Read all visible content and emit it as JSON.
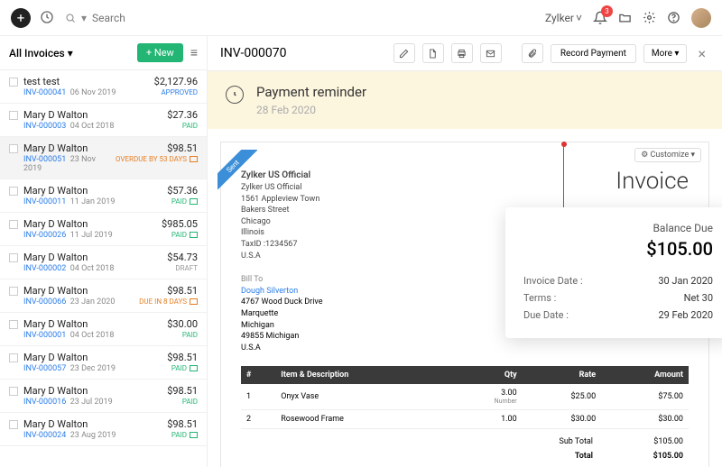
{
  "topbar": {
    "search_placeholder": "Search",
    "org_name": "Zylker",
    "notif_count": "3"
  },
  "sidebar": {
    "title": "All Invoices ▾",
    "new_btn": "+ New",
    "items": [
      {
        "name": "test test",
        "inv": "INV-000041",
        "date": "06 Nov 2019",
        "amount": "$2,127.96",
        "status": "APPROVED",
        "statusClass": "st-approved"
      },
      {
        "name": "Mary D Walton",
        "inv": "INV-000003",
        "date": "04 Oct 2018",
        "amount": "$27.36",
        "status": "PAID",
        "statusClass": "st-paid"
      },
      {
        "name": "Mary D Walton",
        "inv": "INV-000051",
        "date": "23 Nov 2019",
        "amount": "$98.51",
        "status": "OVERDUE BY 53 DAYS",
        "statusClass": "st-overdue",
        "mail": true
      },
      {
        "name": "Mary D Walton",
        "inv": "INV-000011",
        "date": "11 Jan 2019",
        "amount": "$57.36",
        "status": "PAID",
        "statusClass": "st-paid",
        "mail": true
      },
      {
        "name": "Mary D Walton",
        "inv": "INV-000026",
        "date": "11 Jul 2019",
        "amount": "$985.05",
        "status": "PAID",
        "statusClass": "st-paid",
        "mail": true
      },
      {
        "name": "Mary D Walton",
        "inv": "INV-000002",
        "date": "04 Oct 2018",
        "amount": "$54.73",
        "status": "DRAFT",
        "statusClass": "st-draft"
      },
      {
        "name": "Mary D Walton",
        "inv": "INV-000066",
        "date": "23 Jan 2020",
        "amount": "$98.51",
        "status": "DUE IN 8 DAYS",
        "statusClass": "st-due",
        "mail": true
      },
      {
        "name": "Mary D Walton",
        "inv": "INV-000001",
        "date": "04 Oct 2018",
        "amount": "$30.00",
        "status": "PAID",
        "statusClass": "st-paid"
      },
      {
        "name": "Mary D Walton",
        "inv": "INV-000057",
        "date": "23 Dec 2019",
        "amount": "$98.51",
        "status": "PAID",
        "statusClass": "st-paid",
        "mail": true
      },
      {
        "name": "Mary D Walton",
        "inv": "INV-000016",
        "date": "23 Jul 2019",
        "amount": "$98.51",
        "status": "PAID",
        "statusClass": "st-paid"
      },
      {
        "name": "Mary D Walton",
        "inv": "INV-000024",
        "date": "23 Aug 2019",
        "amount": "$98.51",
        "status": "PAID",
        "statusClass": "st-paid",
        "mail": true
      }
    ]
  },
  "detail": {
    "title": "INV-000070",
    "record_payment": "Record Payment",
    "more": "More ▾",
    "reminder_title": "Payment reminder",
    "reminder_date": "28 Feb 2020",
    "customize": "⚙ Customize ▾",
    "sent_label": "Sent",
    "company": {
      "name": "Zylker US Official",
      "l1": "Zylker US Official",
      "l2": "1561 Appleview Town",
      "l3": "Bakers Street",
      "l4": "Chicago",
      "l5": "Illinois",
      "l6": "TaxID :1234567",
      "l7": "U.S.A"
    },
    "billto": {
      "label": "Bill To",
      "name": "Dough Silverton",
      "l1": "4767 Wood Duck Drive",
      "l2": "Marquette",
      "l3": "Michigan",
      "l4": "49855 Michigan",
      "l5": "U.S.A"
    },
    "invoice_label": "Invoice",
    "balance": {
      "label": "Balance Due",
      "amount": "$105.00",
      "rows": [
        {
          "k": "Invoice Date :",
          "v": "30 Jan 2020"
        },
        {
          "k": "Terms :",
          "v": "Net 30"
        },
        {
          "k": "Due Date :",
          "v": "29 Feb 2020"
        }
      ]
    },
    "table": {
      "headers": [
        "#",
        "Item & Description",
        "Qty",
        "Rate",
        "Amount"
      ],
      "rows": [
        {
          "n": "1",
          "desc": "Onyx Vase",
          "qty": "3.00",
          "qtysub": "Number",
          "rate": "$25.00",
          "amt": "$75.00"
        },
        {
          "n": "2",
          "desc": "Rosewood Frame",
          "qty": "1.00",
          "qtysub": "",
          "rate": "$30.00",
          "amt": "$30.00"
        }
      ],
      "subtotal_label": "Sub Total",
      "subtotal": "$105.00",
      "total_label": "Total",
      "total": "$105.00"
    }
  }
}
